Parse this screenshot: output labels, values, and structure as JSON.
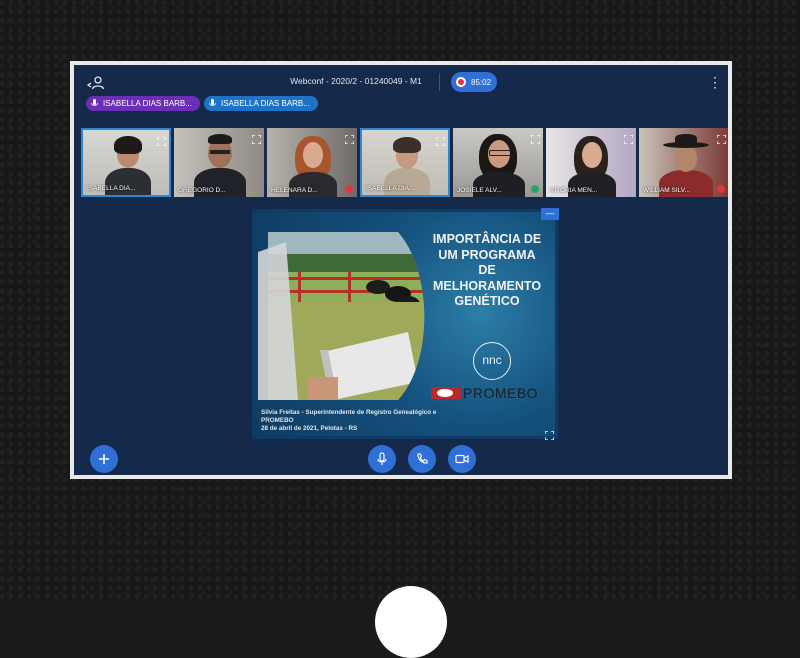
{
  "topbar": {
    "title": "Webconf - 2020/2 - 01240049 - M1",
    "recording_time": "85:02"
  },
  "talking": [
    {
      "name": "ISABELLA DIAS BARB..."
    },
    {
      "name": "ISABELLA DIAS BARB..."
    }
  ],
  "participants": [
    {
      "name": "ISABELLA DIA...",
      "active": true
    },
    {
      "name": "GREGORIO D...",
      "active": false
    },
    {
      "name": "HELENARA D...",
      "active": false
    },
    {
      "name": "ISABELLA DIA...",
      "active": true
    },
    {
      "name": "JOSIELE ALV...",
      "active": false
    },
    {
      "name": "VITORIA MEN...",
      "active": false
    },
    {
      "name": "WILLIAM SILV...",
      "active": false
    }
  ],
  "slide": {
    "headline_lines": [
      "IMPORTÂNCIA DE",
      "UM PROGRAMA",
      "DE",
      "MELHORAMENTO",
      "GENÉTICO"
    ],
    "logo_text": "nnc",
    "promebo_text": "PROMEBO",
    "footer_line1": "Silvia Freitas - Superintendente de Registro Genealógico e",
    "footer_line2": "PROMEBO",
    "footer_line3": "28 de abril de 2021, Pelotas - RS",
    "minimize_label": "—"
  },
  "colors": {
    "app_bg": "#15294a",
    "accent": "#2f6fd6",
    "talking_purple": "#6b2fb6",
    "talking_blue": "#1f73c7",
    "record_red": "#e0373f"
  },
  "icons": [
    "users-icon",
    "kebab-menu-icon",
    "microphone-icon",
    "expand-icon",
    "plus-icon",
    "phone-icon",
    "camera-icon"
  ]
}
